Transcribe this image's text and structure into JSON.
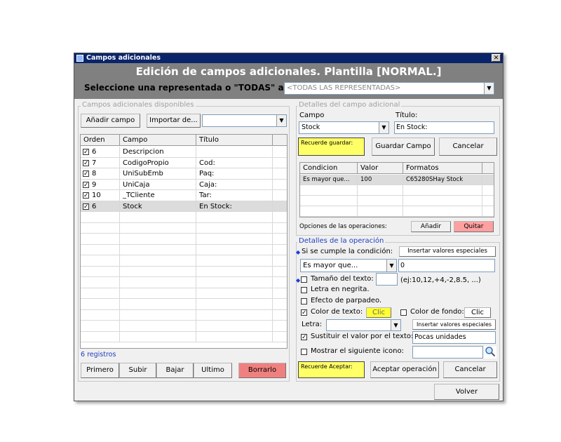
{
  "window": {
    "title": "Campos adicionales",
    "close_glyph": "✕"
  },
  "header": {
    "title": "Edición de campos adicionales. Plantilla [NORMAL.]",
    "select_label": "Seleccione una representada o \"TODAS\" aquí:",
    "representada_value": "<TODAS LAS REPRESENTADAS>"
  },
  "left": {
    "legend": "Campos adicionales disponibles",
    "add_field": "Añadir campo",
    "import_from": "Importar de...",
    "import_value": "",
    "columns": [
      "Orden",
      "Campo",
      "Título"
    ],
    "rows": [
      {
        "checked": true,
        "orden": "6",
        "campo": "Descripcion",
        "titulo": ""
      },
      {
        "checked": true,
        "orden": "7",
        "campo": "CodigoPropio",
        "titulo": "Cod:"
      },
      {
        "checked": true,
        "orden": "8",
        "campo": "UniSubEmb",
        "titulo": "Paq:"
      },
      {
        "checked": true,
        "orden": "9",
        "campo": "UniCaja",
        "titulo": "Caja:"
      },
      {
        "checked": true,
        "orden": "10",
        "campo": "_TCliente",
        "titulo": "Tar:"
      },
      {
        "checked": true,
        "orden": "6",
        "campo": "Stock",
        "titulo": "En Stock:"
      }
    ],
    "record_count": "6 registros",
    "buttons": {
      "first": "Primero",
      "up": "Subir",
      "down": "Bajar",
      "last": "Ultimo",
      "delete": "Borrarlo"
    }
  },
  "details": {
    "legend": "Detalles del campo adicional",
    "campo_label": "Campo",
    "campo_value": "Stock",
    "titulo_label": "Título:",
    "titulo_value": "En Stock:",
    "remember_save": "Recuerde guardar:",
    "save_field": "Guardar Campo",
    "cancel": "Cancelar",
    "ops_columns": [
      "Condicion",
      "Valor",
      "Formatos"
    ],
    "ops_rows": [
      {
        "condicion": "Es mayor que...",
        "valor": "100",
        "formatos": "C65280SHay Stock"
      }
    ],
    "ops_label": "Opciones de las operaciones:",
    "add": "Añadir",
    "remove": "Quitar"
  },
  "operation": {
    "legend": "Detalles de la operación",
    "condition_label": "Si se cumple la condición:",
    "insert_special_1": "Insertar valores especiales",
    "condition_value": "Es mayor que...",
    "condition_input": "0",
    "text_size_label": "Tamaño del texto:",
    "text_size_value": "",
    "text_size_hint": "(ej:10,12,+4,-2,8.5, ...)",
    "bold_label": "Letra en negrita.",
    "blink_label": "Efecto de parpadeo.",
    "text_color_label": "Color de texto:",
    "click_label": "Clic",
    "bg_color_label": "Color de fondo:",
    "bg_click_label": "Clic",
    "font_label": "Letra:",
    "font_value": "",
    "insert_special_2": "Insertar valores especiales",
    "replace_label": "Sustituir el valor por el texto:",
    "replace_value": "Pocas unidades",
    "icon_label": "Mostrar el siguiente icono:",
    "icon_value": "",
    "remember_accept": "Recuerde Aceptar:",
    "accept": "Aceptar operación",
    "cancel": "Cancelar",
    "checks": {
      "text_size": false,
      "bold": false,
      "blink": false,
      "text_color": true,
      "bg_color": false,
      "replace": true,
      "icon": false
    }
  },
  "footer": {
    "back": "Volver"
  },
  "colors": {
    "title_bar": "#0a246a",
    "header_bg": "#808080",
    "delete_btn": "#f08080",
    "remove_btn": "#ffa0a0",
    "highlight": "#ffff66"
  }
}
